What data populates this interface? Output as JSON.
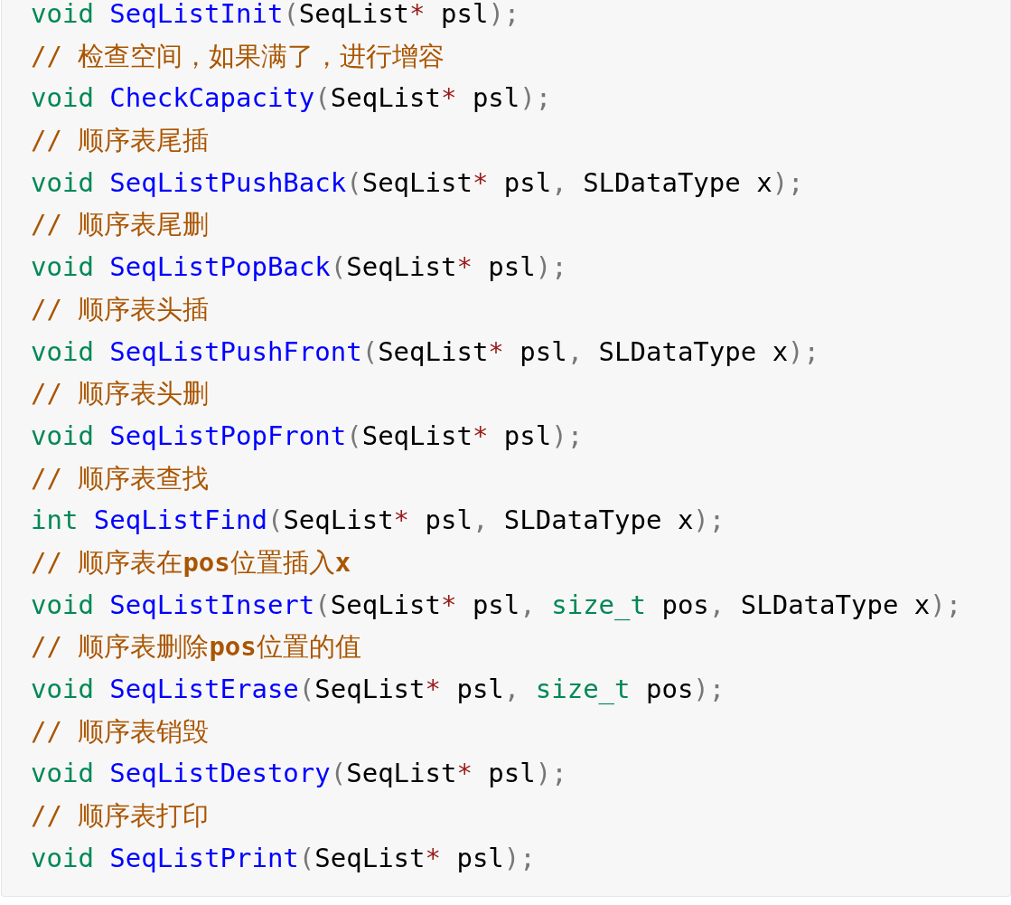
{
  "code_block": {
    "lines": [
      {
        "kind": "code",
        "tokens": [
          {
            "kind": "keyword",
            "text": "void "
          },
          {
            "kind": "function",
            "text": "SeqListInit"
          },
          {
            "kind": "punct",
            "text": "("
          },
          {
            "kind": "plain",
            "text": "SeqList"
          },
          {
            "kind": "operator",
            "text": "*"
          },
          {
            "kind": "plain",
            "text": " psl"
          },
          {
            "kind": "punct",
            "text": ");"
          }
        ]
      },
      {
        "kind": "comment",
        "text": "// 检查空间，如果满了，进行增容"
      },
      {
        "kind": "code",
        "tokens": [
          {
            "kind": "keyword",
            "text": "void "
          },
          {
            "kind": "function",
            "text": "CheckCapacity"
          },
          {
            "kind": "punct",
            "text": "("
          },
          {
            "kind": "plain",
            "text": "SeqList"
          },
          {
            "kind": "operator",
            "text": "*"
          },
          {
            "kind": "plain",
            "text": " psl"
          },
          {
            "kind": "punct",
            "text": ");"
          }
        ]
      },
      {
        "kind": "comment",
        "text": "// 顺序表尾插"
      },
      {
        "kind": "code",
        "tokens": [
          {
            "kind": "keyword",
            "text": "void "
          },
          {
            "kind": "function",
            "text": "SeqListPushBack"
          },
          {
            "kind": "punct",
            "text": "("
          },
          {
            "kind": "plain",
            "text": "SeqList"
          },
          {
            "kind": "operator",
            "text": "*"
          },
          {
            "kind": "plain",
            "text": " psl"
          },
          {
            "kind": "punct",
            "text": ", "
          },
          {
            "kind": "plain",
            "text": "SLDataType x"
          },
          {
            "kind": "punct",
            "text": ");"
          }
        ]
      },
      {
        "kind": "comment",
        "text": "// 顺序表尾删"
      },
      {
        "kind": "code",
        "tokens": [
          {
            "kind": "keyword",
            "text": "void "
          },
          {
            "kind": "function",
            "text": "SeqListPopBack"
          },
          {
            "kind": "punct",
            "text": "("
          },
          {
            "kind": "plain",
            "text": "SeqList"
          },
          {
            "kind": "operator",
            "text": "*"
          },
          {
            "kind": "plain",
            "text": " psl"
          },
          {
            "kind": "punct",
            "text": ");"
          }
        ]
      },
      {
        "kind": "comment",
        "text": "// 顺序表头插"
      },
      {
        "kind": "code",
        "tokens": [
          {
            "kind": "keyword",
            "text": "void "
          },
          {
            "kind": "function",
            "text": "SeqListPushFront"
          },
          {
            "kind": "punct",
            "text": "("
          },
          {
            "kind": "plain",
            "text": "SeqList"
          },
          {
            "kind": "operator",
            "text": "*"
          },
          {
            "kind": "plain",
            "text": " psl"
          },
          {
            "kind": "punct",
            "text": ", "
          },
          {
            "kind": "plain",
            "text": "SLDataType x"
          },
          {
            "kind": "punct",
            "text": ");"
          }
        ]
      },
      {
        "kind": "comment",
        "text": "// 顺序表头删"
      },
      {
        "kind": "code",
        "tokens": [
          {
            "kind": "keyword",
            "text": "void "
          },
          {
            "kind": "function",
            "text": "SeqListPopFront"
          },
          {
            "kind": "punct",
            "text": "("
          },
          {
            "kind": "plain",
            "text": "SeqList"
          },
          {
            "kind": "operator",
            "text": "*"
          },
          {
            "kind": "plain",
            "text": " psl"
          },
          {
            "kind": "punct",
            "text": ");"
          }
        ]
      },
      {
        "kind": "comment",
        "text": "// 顺序表查找"
      },
      {
        "kind": "code",
        "tokens": [
          {
            "kind": "keyword",
            "text": "int "
          },
          {
            "kind": "function",
            "text": "SeqListFind"
          },
          {
            "kind": "punct",
            "text": "("
          },
          {
            "kind": "plain",
            "text": "SeqList"
          },
          {
            "kind": "operator",
            "text": "*"
          },
          {
            "kind": "plain",
            "text": " psl"
          },
          {
            "kind": "punct",
            "text": ", "
          },
          {
            "kind": "plain",
            "text": "SLDataType x"
          },
          {
            "kind": "punct",
            "text": ");"
          }
        ]
      },
      {
        "kind": "comment",
        "text": "// 顺序表在**pos**位置插入**x**"
      },
      {
        "kind": "code",
        "tokens": [
          {
            "kind": "keyword",
            "text": "void "
          },
          {
            "kind": "function",
            "text": "SeqListInsert"
          },
          {
            "kind": "punct",
            "text": "("
          },
          {
            "kind": "plain",
            "text": "SeqList"
          },
          {
            "kind": "operator",
            "text": "*"
          },
          {
            "kind": "plain",
            "text": " psl"
          },
          {
            "kind": "punct",
            "text": ", "
          },
          {
            "kind": "keyword",
            "text": "size_t"
          },
          {
            "kind": "plain",
            "text": " pos"
          },
          {
            "kind": "punct",
            "text": ", "
          },
          {
            "kind": "plain",
            "text": "SLDataType x"
          },
          {
            "kind": "punct",
            "text": ");"
          }
        ]
      },
      {
        "kind": "comment",
        "text": "// 顺序表删除**pos**位置的值"
      },
      {
        "kind": "code",
        "tokens": [
          {
            "kind": "keyword",
            "text": "void "
          },
          {
            "kind": "function",
            "text": "SeqListErase"
          },
          {
            "kind": "punct",
            "text": "("
          },
          {
            "kind": "plain",
            "text": "SeqList"
          },
          {
            "kind": "operator",
            "text": "*"
          },
          {
            "kind": "plain",
            "text": " psl"
          },
          {
            "kind": "punct",
            "text": ", "
          },
          {
            "kind": "keyword",
            "text": "size_t"
          },
          {
            "kind": "plain",
            "text": " pos"
          },
          {
            "kind": "punct",
            "text": ");"
          }
        ]
      },
      {
        "kind": "comment",
        "text": "// 顺序表销毁"
      },
      {
        "kind": "code",
        "tokens": [
          {
            "kind": "keyword",
            "text": "void "
          },
          {
            "kind": "function",
            "text": "SeqListDestory"
          },
          {
            "kind": "punct",
            "text": "("
          },
          {
            "kind": "plain",
            "text": "SeqList"
          },
          {
            "kind": "operator",
            "text": "*"
          },
          {
            "kind": "plain",
            "text": " psl"
          },
          {
            "kind": "punct",
            "text": ");"
          }
        ]
      },
      {
        "kind": "comment",
        "text": "// 顺序表打印"
      },
      {
        "kind": "code",
        "tokens": [
          {
            "kind": "keyword",
            "text": "void "
          },
          {
            "kind": "function",
            "text": "SeqListPrint"
          },
          {
            "kind": "punct",
            "text": "("
          },
          {
            "kind": "plain",
            "text": "SeqList"
          },
          {
            "kind": "operator",
            "text": "*"
          },
          {
            "kind": "plain",
            "text": " psl"
          },
          {
            "kind": "punct",
            "text": ");"
          }
        ]
      }
    ]
  }
}
